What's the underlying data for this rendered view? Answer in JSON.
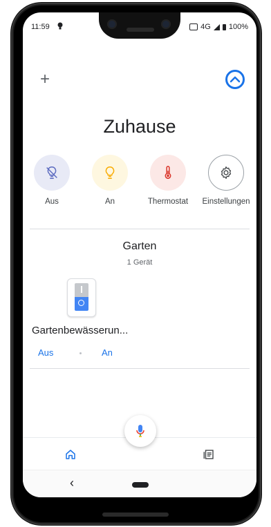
{
  "status": {
    "time": "11:59",
    "network": "4G",
    "battery": "100%"
  },
  "header": {
    "add_label": "+",
    "title": "Zuhause"
  },
  "quick_actions": [
    {
      "label": "Aus",
      "icon": "lightbulb-off-icon",
      "bg": "#e8eaf6",
      "color": "#5c6bc0"
    },
    {
      "label": "An",
      "icon": "lightbulb-on-icon",
      "bg": "#fef7e0",
      "color": "#f9ab00"
    },
    {
      "label": "Thermostat",
      "icon": "thermometer-icon",
      "bg": "#fce8e6",
      "color": "#d93025"
    },
    {
      "label": "Einstellungen",
      "icon": "gear-icon",
      "bg": "#ffffff",
      "color": "#3c4043"
    }
  ],
  "room": {
    "name": "Garten",
    "count": "1 Gerät",
    "device": {
      "name": "Gartenbewässerun...",
      "off_label": "Aus",
      "on_label": "An"
    }
  },
  "nav": {
    "back": "‹"
  },
  "colors": {
    "accent": "#1a73e8"
  }
}
